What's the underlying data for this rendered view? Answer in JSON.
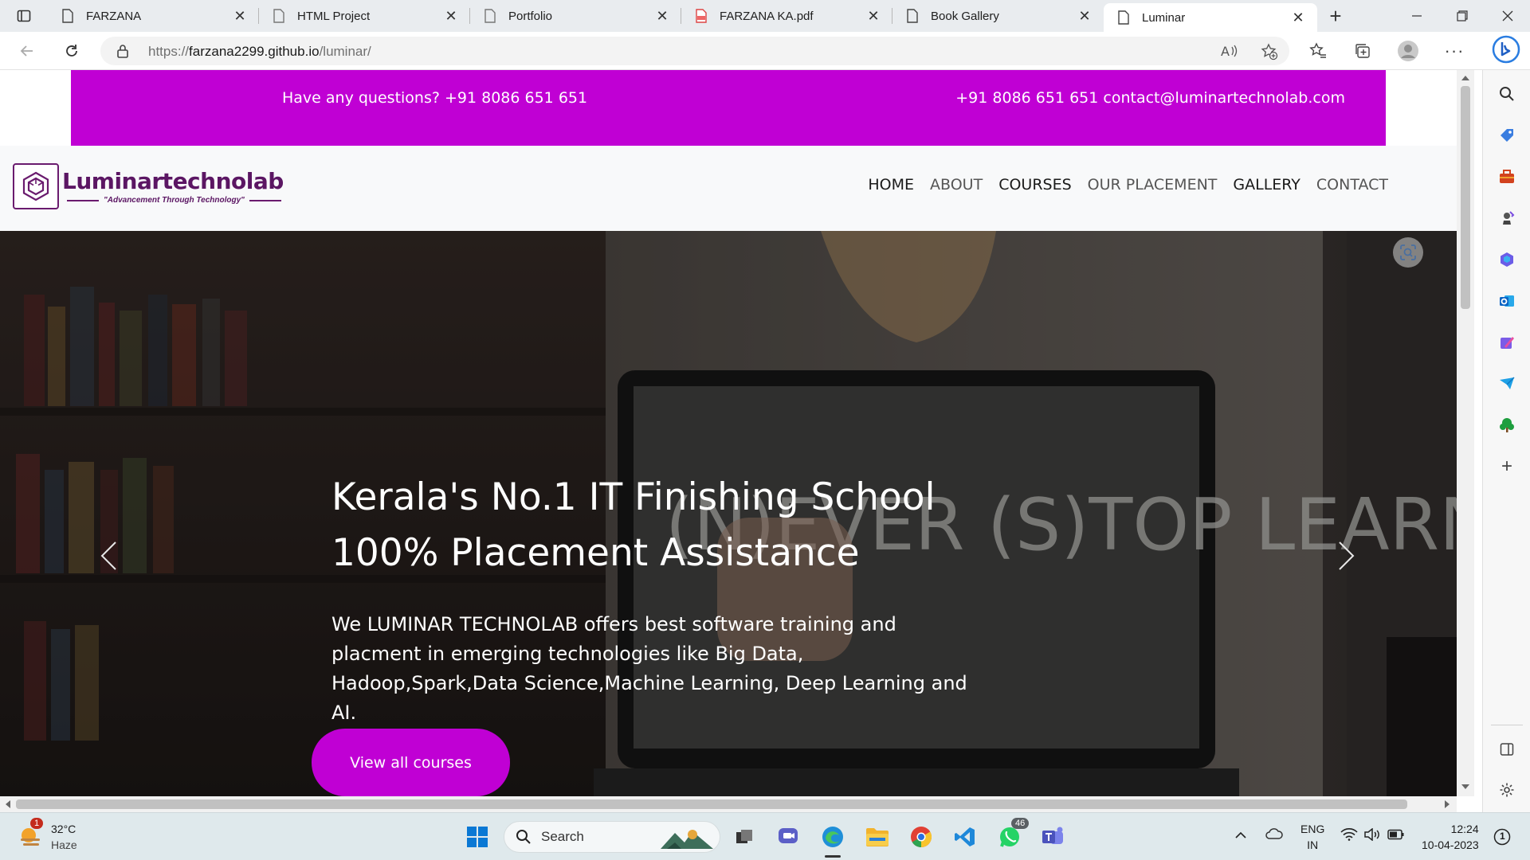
{
  "browser": {
    "tabs": [
      {
        "title": "FARZANA",
        "icon": "page-icon"
      },
      {
        "title": "HTML Project",
        "icon": "page-icon"
      },
      {
        "title": "Portfolio",
        "icon": "page-icon"
      },
      {
        "title": "FARZANA KA.pdf",
        "icon": "pdf-icon"
      },
      {
        "title": "Book Gallery",
        "icon": "page-icon"
      },
      {
        "title": "Luminar",
        "icon": "page-icon",
        "active": true
      }
    ],
    "url_prefix": "https://",
    "url_host": "farzana2299.github.io",
    "url_path": "/luminar/"
  },
  "site": {
    "topbar": {
      "question": "Have any questions? +91 8086 651 651",
      "contact": "+91 8086 651 651 contact@luminartechnolab.com"
    },
    "logo": {
      "name": "Luminartechnolab",
      "tagline": "\"Advancement Through Technology\""
    },
    "menu": [
      "HOME",
      "ABOUT",
      "COURSES",
      "OUR PLACEMENT",
      "GALLERY",
      "CONTACT"
    ],
    "hero": {
      "title_line1": "Kerala's No.1 IT Finishing School",
      "title_line2": "100% Placement Assistance",
      "description": "We LUMINAR TECHNOLAB offers best software training and placment in emerging technologies like Big Data, Hadoop,Spark,Data Science,Machine Learning, Deep Learning and AI.",
      "button": "View all courses",
      "chalk_text": "(N)EVER (S)TOP LEARNING"
    },
    "colors": {
      "accent": "#c000d4",
      "logo": "#5b1663"
    }
  },
  "taskbar": {
    "weather_temp": "32°C",
    "weather_cond": "Haze",
    "weather_badge": "1",
    "search_label": "Search",
    "whatsapp_badge": "46",
    "lang_line1": "ENG",
    "lang_line2": "IN",
    "time": "12:24",
    "date": "10-04-2023",
    "notif_count": "1"
  }
}
